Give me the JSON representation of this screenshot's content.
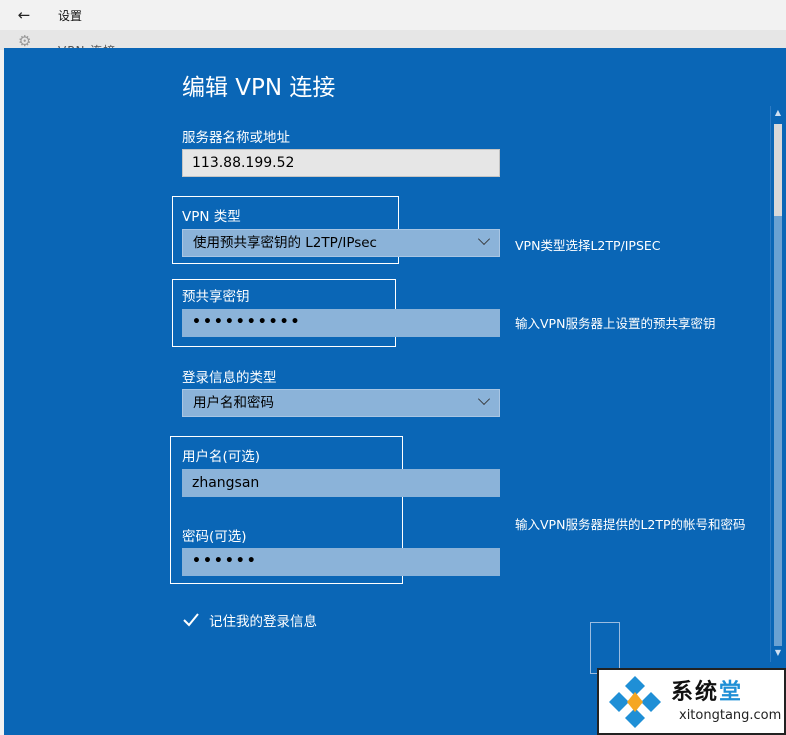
{
  "window": {
    "title": "设置",
    "back_icon": "arrow-left-icon",
    "underlay_text": "VPN 连接"
  },
  "dialog": {
    "title": "编辑 VPN 连接",
    "server": {
      "label": "服务器名称或地址",
      "value": "113.88.199.52"
    },
    "vpn_type": {
      "label": "VPN 类型",
      "selected": "使用预共享密钥的 L2TP/IPsec"
    },
    "psk": {
      "label": "预共享密钥",
      "value": "••••••••••"
    },
    "login_type": {
      "label": "登录信息的类型",
      "selected": "用户名和密码"
    },
    "username": {
      "label": "用户名(可选)",
      "value": "zhangsan"
    },
    "password": {
      "label": "密码(可选)",
      "value": "••••••"
    },
    "remember": {
      "label": "记住我的登录信息",
      "checked": true
    }
  },
  "notes": {
    "vpn_type": "VPN类型选择L2TP/IPSEC",
    "psk": "输入VPN服务器上设置的预共享密钥",
    "account": "输入VPN服务器提供的L2TP的帐号和密码"
  },
  "watermark": {
    "name_part1": "系统",
    "name_part2": "堂",
    "url": "xitongtang.com"
  },
  "colors": {
    "dialog_bg": "#0a66b6",
    "input_bg": "#e6e6e6",
    "select_bg": "#8bb3d9",
    "watermark_accent": "#1f8fd6"
  }
}
